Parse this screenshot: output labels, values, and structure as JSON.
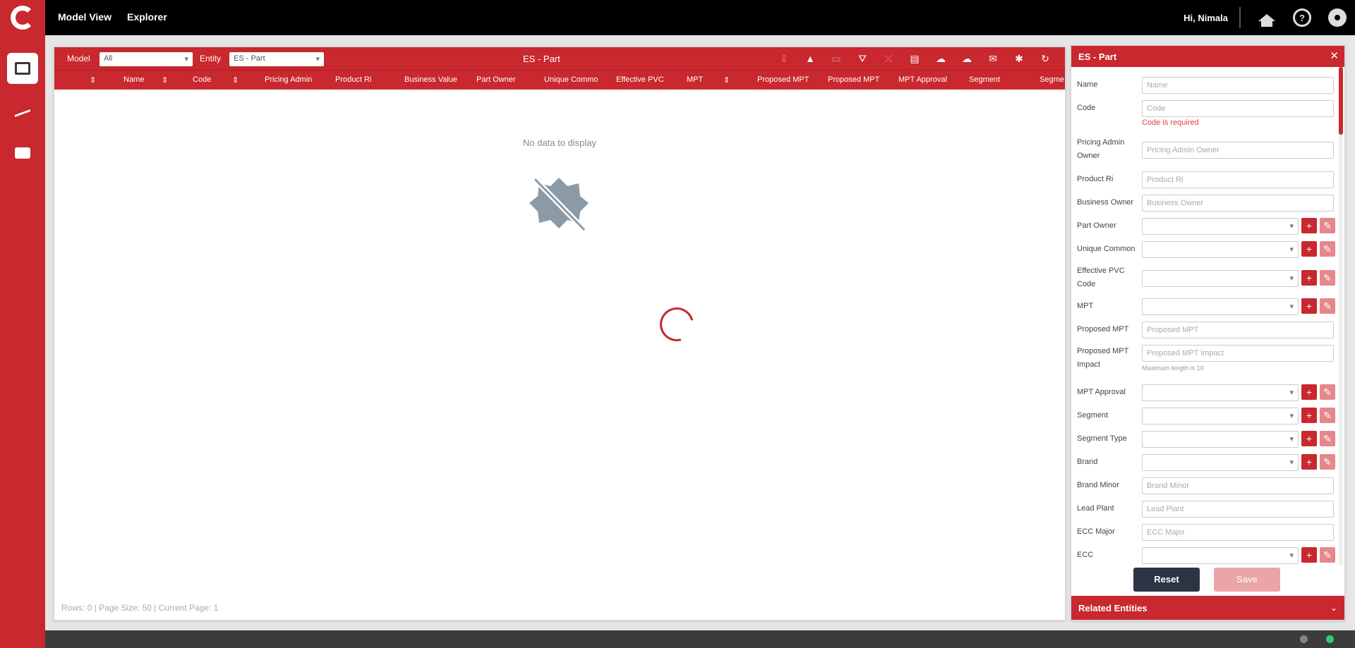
{
  "app": {
    "nav": [
      "Model View",
      "Explorer"
    ],
    "greeting": "Hi, Nimala"
  },
  "toolbar": {
    "model_label": "Model",
    "model_value": "All",
    "entity_label": "Entity",
    "entity_value": "ES - Part",
    "title": "ES - Part"
  },
  "columns": [
    "Name",
    "Code",
    "Pricing Admin",
    "Product Ri",
    "Business Value",
    "Part Owner",
    "Unique Commo",
    "Effective PVC",
    "MPT",
    "Proposed MPT",
    "Proposed MPT",
    "MPT Approval",
    "Segment",
    "Segme"
  ],
  "grid": {
    "empty_message": "No data to display",
    "status": "Rows: 0 | Page Size: 50 | Current Page: 1"
  },
  "panel": {
    "title": "ES - Part",
    "fields": {
      "name": {
        "label": "Name",
        "placeholder": "Name"
      },
      "code": {
        "label": "Code",
        "placeholder": "Code",
        "error": "Code is required"
      },
      "pricing_admin": {
        "label": "Pricing Admin Owner",
        "placeholder": "Pricing Admin Owner"
      },
      "product_ri": {
        "label": "Product Ri",
        "placeholder": "Product Ri"
      },
      "business_owner": {
        "label": "Business Owner",
        "placeholder": "Business Owner"
      },
      "part_owner": {
        "label": "Part Owner"
      },
      "unique_common": {
        "label": "Unique Common"
      },
      "effective_pvc": {
        "label": "Effective PVC Code"
      },
      "mpt": {
        "label": "MPT"
      },
      "proposed_mpt": {
        "label": "Proposed MPT",
        "placeholder": "Proposed MPT"
      },
      "proposed_mpt_impact": {
        "label": "Proposed MPT Impact",
        "placeholder": "Proposed MPT Impact",
        "hint": "Maximum length is 10"
      },
      "mpt_approval": {
        "label": "MPT Approval"
      },
      "segment": {
        "label": "Segment"
      },
      "segment_type": {
        "label": "Segment Type"
      },
      "brand": {
        "label": "Brand"
      },
      "brand_minor": {
        "label": "Brand Minor",
        "placeholder": "Brand Minor"
      },
      "lead_plant": {
        "label": "Lead Plant",
        "placeholder": "Lead Plant"
      },
      "ecc_major": {
        "label": "ECC Major",
        "placeholder": "ECC Major"
      },
      "ecc": {
        "label": "ECC"
      }
    },
    "reset_label": "Reset",
    "save_label": "Save",
    "related_title": "Related Entities"
  },
  "colors": {
    "brand_red": "#c8282e",
    "dark_button": "#2b3543"
  }
}
